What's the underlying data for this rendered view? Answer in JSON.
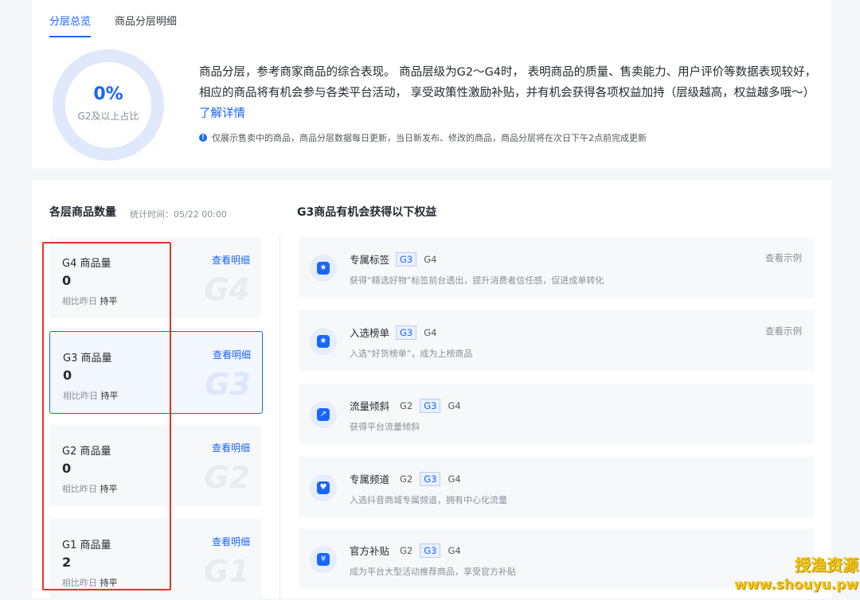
{
  "tabs": [
    "分层总览",
    "商品分层明细"
  ],
  "donut": {
    "value": "0%",
    "label": "G2及以上占比",
    "fraction": 0
  },
  "intro": {
    "text": "商品分层，参考商家商品的综合表现。 商品层级为G2～G4时， 表明商品的质量、售卖能力、用户评价等数据表现较好，相应的商品将有机会参与各类平台活动， 享受政策性激励补贴，并有机会获得各项权益加持（层级越高，权益越多哦～）",
    "link": "了解详情"
  },
  "notice": "仅展示售卖中的商品，商品分层数据每日更新，当日新发布、修改的商品，商品分层将在次日下午2点前完成更新",
  "tiers_section": {
    "title": "各层商品数量",
    "stat_time": "统计时间：05/22 00:00"
  },
  "tiers": [
    {
      "name": "G4 商品量",
      "value": "0",
      "cmp_label": "相比昨日",
      "cmp_value": "持平",
      "link": "查看明细",
      "badge": "G4",
      "selected": false
    },
    {
      "name": "G3 商品量",
      "value": "0",
      "cmp_label": "相比昨日",
      "cmp_value": "持平",
      "link": "查看明细",
      "badge": "G3",
      "selected": true
    },
    {
      "name": "G2 商品量",
      "value": "0",
      "cmp_label": "相比昨日",
      "cmp_value": "持平",
      "link": "查看明细",
      "badge": "G2",
      "selected": false
    },
    {
      "name": "G1 商品量",
      "value": "2",
      "cmp_label": "相比昨日",
      "cmp_value": "持平",
      "link": "查看明细",
      "badge": "G1",
      "selected": false
    }
  ],
  "rights_section": {
    "title": "G3商品有机会获得以下权益"
  },
  "rights": [
    {
      "title": "专属标签",
      "chips": [
        "G3",
        "G4"
      ],
      "highlight": "G3",
      "desc": "获得“精选好物”标签前台透出，提升消费者信任感，促进成单转化",
      "example": "查看示例",
      "icon": "star-tag-icon",
      "glyph": "★"
    },
    {
      "title": "入选榜单",
      "chips": [
        "G3",
        "G4"
      ],
      "highlight": "G3",
      "desc": "入选“好货榜单”，成为上榜商品",
      "example": "查看示例",
      "icon": "ranking-badge-icon",
      "glyph": "★"
    },
    {
      "title": "流量倾斜",
      "chips": [
        "G2",
        "G3",
        "G4"
      ],
      "highlight": "G3",
      "desc": "获得平台流量倾斜",
      "example": "",
      "icon": "trend-chart-icon",
      "glyph": "↗"
    },
    {
      "title": "专属频道",
      "chips": [
        "G2",
        "G3",
        "G4"
      ],
      "highlight": "G3",
      "desc": "入选抖音商城专属频道，拥有中心化流量",
      "example": "",
      "icon": "channel-heart-icon",
      "glyph": "♥"
    },
    {
      "title": "官方补贴",
      "chips": [
        "G2",
        "G3",
        "G4"
      ],
      "highlight": "G3",
      "desc": "成为平台大型活动推荐商品，享受官方补贴",
      "example": "",
      "icon": "yen-subsidy-icon",
      "glyph": "¥"
    }
  ],
  "watermark": {
    "line1": "授渔资源",
    "line2": "www.shouyu.pw"
  },
  "colors": {
    "accent": "#1966ff",
    "annotation": "#e5322d",
    "watermark": "#f2c311"
  }
}
